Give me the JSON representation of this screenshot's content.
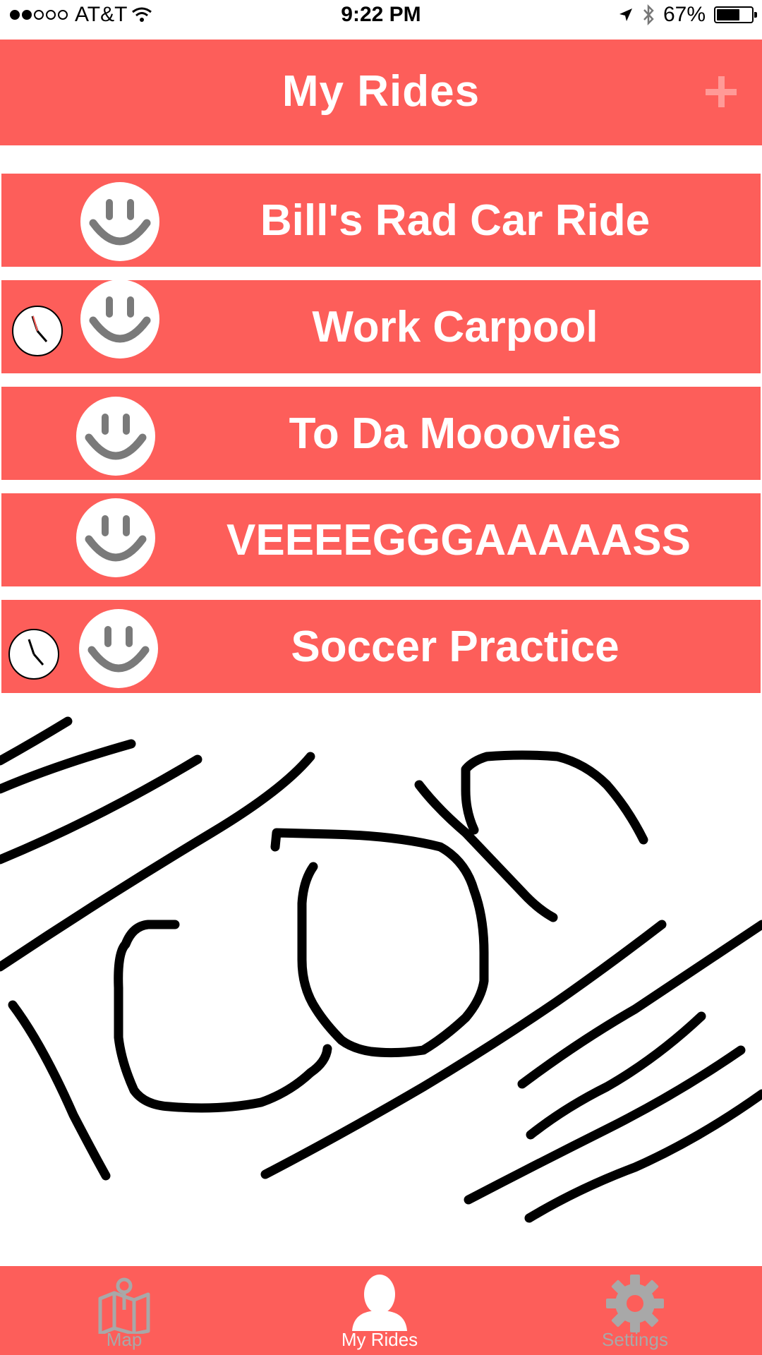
{
  "status_bar": {
    "carrier": "AT&T",
    "time": "9:22 PM",
    "battery_percent": "67%",
    "battery_level": 0.67
  },
  "header": {
    "title": "My Rides",
    "add_icon": "plus-icon"
  },
  "rides": [
    {
      "name": "Bill's Rad Car Ride",
      "scheduled": false
    },
    {
      "name": "Work Carpool",
      "scheduled": true
    },
    {
      "name": "To Da Mooovies",
      "scheduled": false
    },
    {
      "name": "VEEEEGGGAAAAASS",
      "scheduled": false
    },
    {
      "name": "Soccer Practice",
      "scheduled": true
    }
  ],
  "tabs": [
    {
      "label": "Map",
      "icon": "map-icon",
      "active": false
    },
    {
      "label": "My Rides",
      "icon": "person-icon",
      "active": true
    },
    {
      "label": "Settings",
      "icon": "gear-icon",
      "active": false
    }
  ],
  "colors": {
    "accent": "#fd5e5a",
    "smiley_fill": "#ffffff",
    "smiley_features": "#7a7a7a",
    "inactive_tab": "#a8a8a8",
    "active_tab": "#ffffff"
  }
}
